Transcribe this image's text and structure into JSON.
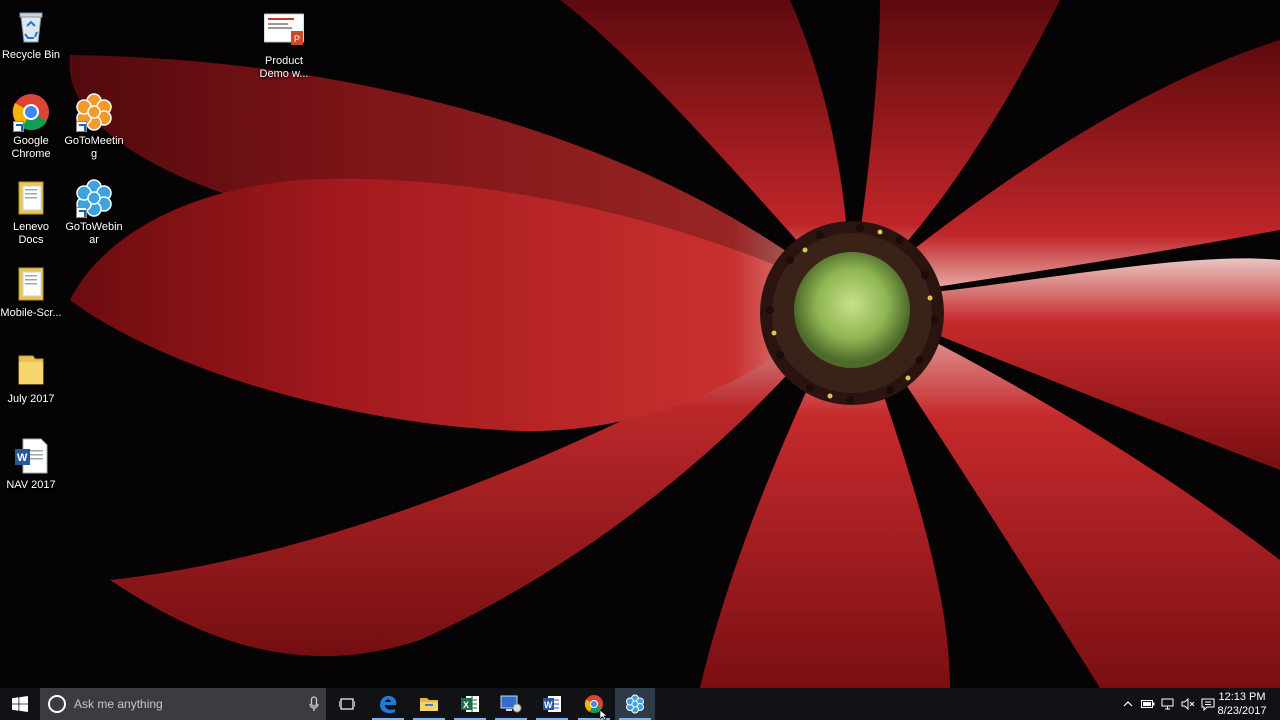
{
  "desktop": {
    "icons": [
      {
        "name": "recycle-bin",
        "label": "Recycle Bin",
        "icon": "recycle-bin-icon"
      },
      {
        "name": "product-demo",
        "label": "Product Demo w...",
        "icon": "powerpoint-file-icon"
      },
      {
        "name": "google-chrome",
        "label": "Google Chrome",
        "icon": "chrome-icon"
      },
      {
        "name": "gotomeeting",
        "label": "GoToMeeting",
        "icon": "gotomeeting-icon"
      },
      {
        "name": "lenevo-docs",
        "label": "Lenevo Docs",
        "icon": "folder-docs-icon"
      },
      {
        "name": "gotowebinar",
        "label": "GoToWebinar",
        "icon": "gotowebinar-icon"
      },
      {
        "name": "mobile-scr",
        "label": "Mobile-Scr...",
        "icon": "folder-docs-icon"
      },
      {
        "name": "july-2017",
        "label": "July 2017",
        "icon": "folder-icon"
      },
      {
        "name": "nav-2017",
        "label": "NAV 2017",
        "icon": "word-file-icon"
      }
    ]
  },
  "taskbar": {
    "search_placeholder": "Ask me anything",
    "pinned": [
      "task-view-icon",
      "edge-icon",
      "file-explorer-icon",
      "excel-icon",
      "remote-desktop-icon",
      "word-icon",
      "chrome-icon",
      "gotowebinar-icon"
    ],
    "clock": {
      "time": "12:13 PM",
      "date": "8/23/2017"
    }
  },
  "colors": {
    "taskbar": "#101215",
    "search": "#3a3c40",
    "accent": "#7fb2e8"
  }
}
